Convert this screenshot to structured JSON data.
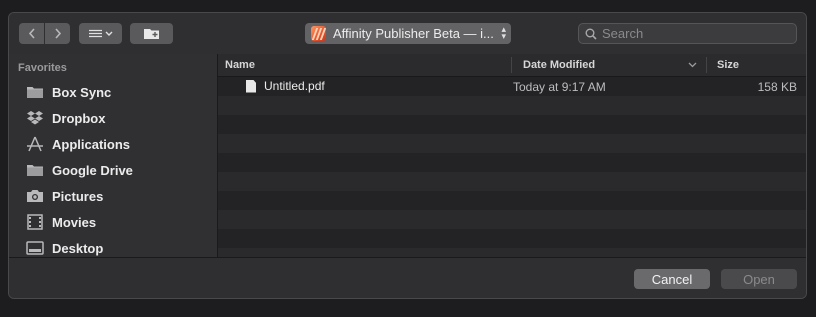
{
  "toolbar": {
    "back_icon": "chevron-left-icon",
    "forward_icon": "chevron-right-icon",
    "view_icon": "list-view-icon",
    "new_folder_icon": "new-folder-icon",
    "location": "Affinity Publisher Beta — i...",
    "search_placeholder": "Search"
  },
  "sidebar": {
    "header": "Favorites",
    "items": [
      {
        "label": "Box Sync",
        "icon": "folder-icon"
      },
      {
        "label": "Dropbox",
        "icon": "dropbox-icon"
      },
      {
        "label": "Applications",
        "icon": "applications-icon"
      },
      {
        "label": "Google Drive",
        "icon": "folder-icon"
      },
      {
        "label": "Pictures",
        "icon": "camera-icon"
      },
      {
        "label": "Movies",
        "icon": "film-icon"
      },
      {
        "label": "Desktop",
        "icon": "desktop-icon"
      }
    ]
  },
  "list": {
    "columns": {
      "name": "Name",
      "date": "Date Modified",
      "size": "Size"
    },
    "files": [
      {
        "name": "Untitled.pdf",
        "date": "Today at 9:17 AM",
        "size": "158 KB"
      }
    ]
  },
  "buttons": {
    "cancel": "Cancel",
    "open": "Open"
  }
}
